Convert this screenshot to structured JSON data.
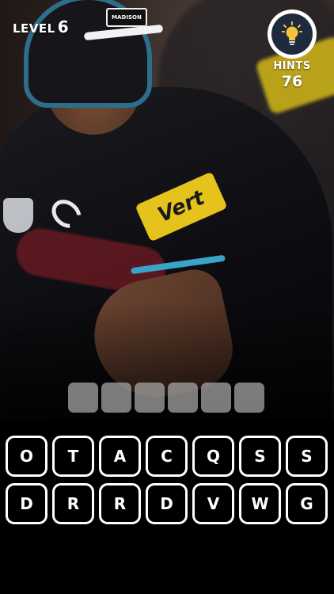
{
  "hud": {
    "level_label": "LEVEL",
    "level_number": "6",
    "hints_label": "HINTS",
    "hints_count": "76",
    "hint_icon": "lightbulb-icon"
  },
  "photo": {
    "description_icon": "player-photo",
    "sponsor_text": "Vert",
    "cap_logo_text": "MADISON"
  },
  "answer": {
    "slot_count": 6,
    "slots": [
      "",
      "",
      "",
      "",
      "",
      ""
    ]
  },
  "keyboard": {
    "rows": [
      [
        "O",
        "T",
        "A",
        "C",
        "Q",
        "S",
        "S"
      ],
      [
        "D",
        "R",
        "R",
        "D",
        "V",
        "W",
        "G"
      ]
    ]
  },
  "colors": {
    "background": "#000000",
    "key_border": "#ffffff",
    "slot_fill": "#aaaaaa",
    "hint_circle": "#1f2a3d",
    "bulb": "#f5c33b",
    "sponsor_yellow": "#e6c21c",
    "trim_blue": "#3aa3c9"
  }
}
